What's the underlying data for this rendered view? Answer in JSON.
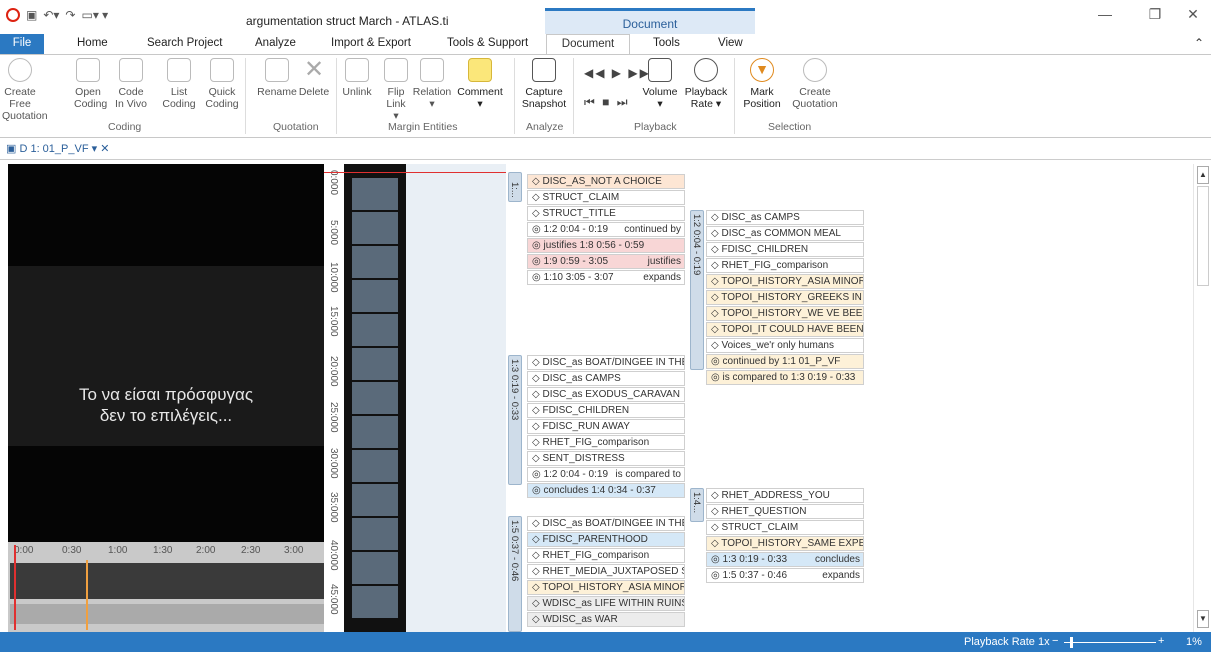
{
  "window": {
    "title": "argumentation struct March - ATLAS.ti",
    "context_group": "Document"
  },
  "tabs": [
    "File",
    "Home",
    "Search Project",
    "Analyze",
    "Import & Export",
    "Tools & Support",
    "Document",
    "Tools",
    "View"
  ],
  "ribbon": {
    "buttons": [
      "Create Free Quotation",
      "Open Coding",
      "Code In Vivo",
      "List Coding",
      "Quick Coding",
      "Rename",
      "Delete",
      "Unlink",
      "Flip Link",
      "Relation",
      "Comment",
      "Capture Snapshot",
      "Volume",
      "Playback Rate",
      "Mark Position",
      "Create Quotation"
    ],
    "groups": [
      "Coding",
      "Quotation",
      "Margin Entities",
      "Analyze",
      "Playback",
      "Selection"
    ]
  },
  "doc_tab": "D 1: 01_P_VF",
  "video": {
    "caption_line1": "Το να είσαι πρόσφυγας",
    "caption_line2": "δεν το επιλέγεις..."
  },
  "timeline_labels": [
    "0:00",
    "0:30",
    "1:00",
    "1:30",
    "2:00",
    "2:30",
    "3:00"
  ],
  "ruler_labels": [
    "0:000",
    "5:000",
    "10:000",
    "15:000",
    "20:000",
    "25:000",
    "30:000",
    "35:000",
    "40:000",
    "45:000"
  ],
  "segments": [
    "1:...",
    "1:2 0:04 - 0:19",
    "1:3 0:19 - 0:33",
    "1:4...",
    "1:5 0:37 - 0:46"
  ],
  "margin": {
    "col1a": [
      "DISC_AS_NOT A CHOICE",
      "STRUCT_CLAIM",
      "STRUCT_TITLE",
      "1:2 0:04 - 0:19",
      "justifies 1:8 0:56 - 0:59",
      "1:9 0:59 - 3:05",
      "1:10 3:05 - 3:07"
    ],
    "col1a_right": [
      "",
      "",
      "",
      "continued by",
      "",
      "justifies",
      "expands"
    ],
    "col1b": [
      "DISC_as BOAT/DINGEE IN THE...",
      "DISC_as CAMPS",
      "DISC_as EXODUS_CARAVAN",
      "FDISC_CHILDREN",
      "FDISC_RUN AWAY",
      "RHET_FIG_comparison",
      "SENT_DISTRESS",
      "1:2 0:04 - 0:19",
      "concludes 1:4 0:34 - 0:37"
    ],
    "col1b_right": [
      "",
      "",
      "",
      "",
      "",
      "",
      "",
      "is compared to",
      ""
    ],
    "col1c": [
      "DISC_as BOAT/DINGEE IN THE...",
      "FDISC_PARENTHOOD",
      "RHET_FIG_comparison",
      "RHET_MEDIA_JUXTAPOSED SP...",
      "TOPOI_HISTORY_ASIA MINOR...",
      "WDISC_as LIFE WITHIN RUINS",
      "WDISC_as WAR"
    ],
    "col2a": [
      "DISC_as CAMPS",
      "DISC_as COMMON MEAL",
      "FDISC_CHILDREN",
      "RHET_FIG_comparison",
      "TOPOI_HISTORY_ASIA MINOR...",
      "TOPOI_HISTORY_GREEKS IN S...",
      "TOPOI_HISTORY_WE VE BEEN...",
      "TOPOI_IT COULD HAVE BEEN...",
      "Voices_we'r only humans",
      "continued by 1:1 01_P_VF",
      "is compared to 1:3 0:19 - 0:33"
    ],
    "col2b": [
      "RHET_ADDRESS_YOU",
      "RHET_QUESTION",
      "STRUCT_CLAIM",
      "TOPOI_HISTORY_SAME EXPERI...",
      "1:3 0:19 - 0:33",
      "1:5 0:37 - 0:46"
    ],
    "col2b_right": [
      "",
      "",
      "",
      "",
      "concludes",
      "expands"
    ]
  },
  "status": {
    "playback": "Playback Rate 1x",
    "zoom": "1%"
  }
}
